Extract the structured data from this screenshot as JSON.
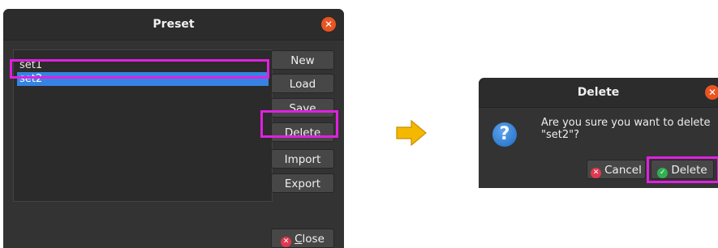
{
  "preset_dialog": {
    "title": "Preset",
    "close_icon": "close-icon",
    "list_items": [
      "set1",
      "set2"
    ],
    "selected_item": "set2",
    "buttons": {
      "new": "New",
      "load": "Load",
      "save": "Save",
      "delete": "Delete",
      "import": "Import",
      "export": "Export",
      "close_prefix": "",
      "close_mnemonic": "C",
      "close_rest": "lose"
    }
  },
  "arrow_icon": "right-arrow-icon",
  "delete_dialog": {
    "title": "Delete",
    "close_icon": "close-icon",
    "icon": "question-icon",
    "message": "Are you sure you want to delete\n\"set2\"?",
    "cancel_label": "Cancel",
    "delete_label": "Delete"
  },
  "colors": {
    "highlight": "#e020e0",
    "selection": "#3584e4",
    "close_button": "#e95420",
    "arrow": "#f5b800"
  }
}
